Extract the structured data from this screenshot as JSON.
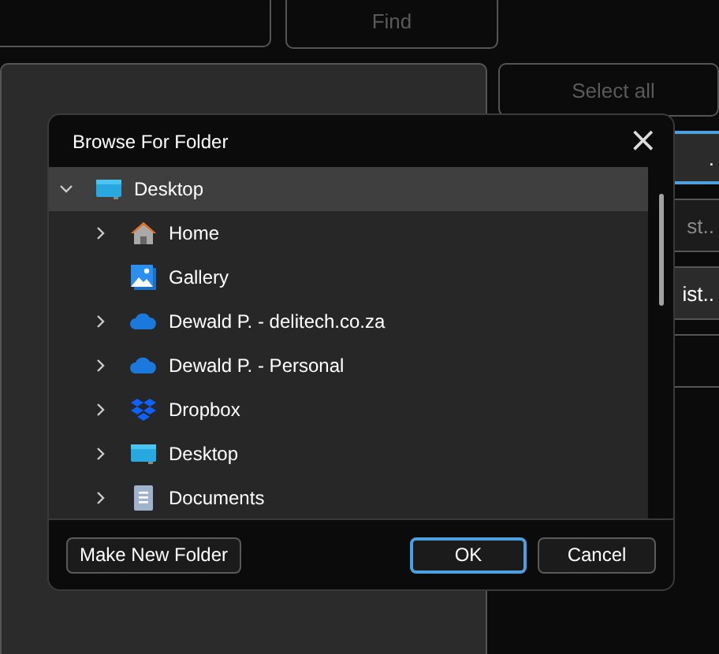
{
  "background": {
    "find_button": {
      "label": "Find",
      "disabled": true
    },
    "side_buttons": [
      {
        "label": "Select all",
        "disabled": true,
        "focused": false
      },
      {
        "label": ".",
        "disabled": false,
        "focused": true
      },
      {
        "label": "st..",
        "disabled": true,
        "focused": false
      },
      {
        "label": "ist..",
        "disabled": false,
        "focused": false
      },
      {
        "disabled": false,
        "focused": false
      }
    ]
  },
  "dialog": {
    "title": "Browse For Folder",
    "close": "×",
    "tree": [
      {
        "label": "Desktop",
        "kind": "desktop",
        "expanded": true,
        "selected": true,
        "children": [
          {
            "label": "Home",
            "kind": "home",
            "expanded": false,
            "expandable": true,
            "selected": false
          },
          {
            "label": "Gallery",
            "kind": "gallery",
            "expandable": false,
            "selected": false
          },
          {
            "label": "Dewald P. - delitech.co.za",
            "kind": "cloud",
            "expanded": false,
            "expandable": true,
            "selected": false
          },
          {
            "label": "Dewald P. - Personal",
            "kind": "cloud",
            "expanded": false,
            "expandable": true,
            "selected": false
          },
          {
            "label": "Dropbox",
            "kind": "dropbox",
            "expanded": false,
            "expandable": true,
            "selected": false
          },
          {
            "label": "Desktop",
            "kind": "desktop",
            "expanded": false,
            "expandable": true,
            "selected": false
          },
          {
            "label": "Documents",
            "kind": "documents",
            "expanded": false,
            "expandable": true,
            "selected": false
          }
        ]
      }
    ],
    "buttons": [
      {
        "label": "Make New Folder",
        "default": false
      },
      {
        "label": "OK",
        "default": true
      },
      {
        "label": "Cancel",
        "default": false
      }
    ]
  }
}
